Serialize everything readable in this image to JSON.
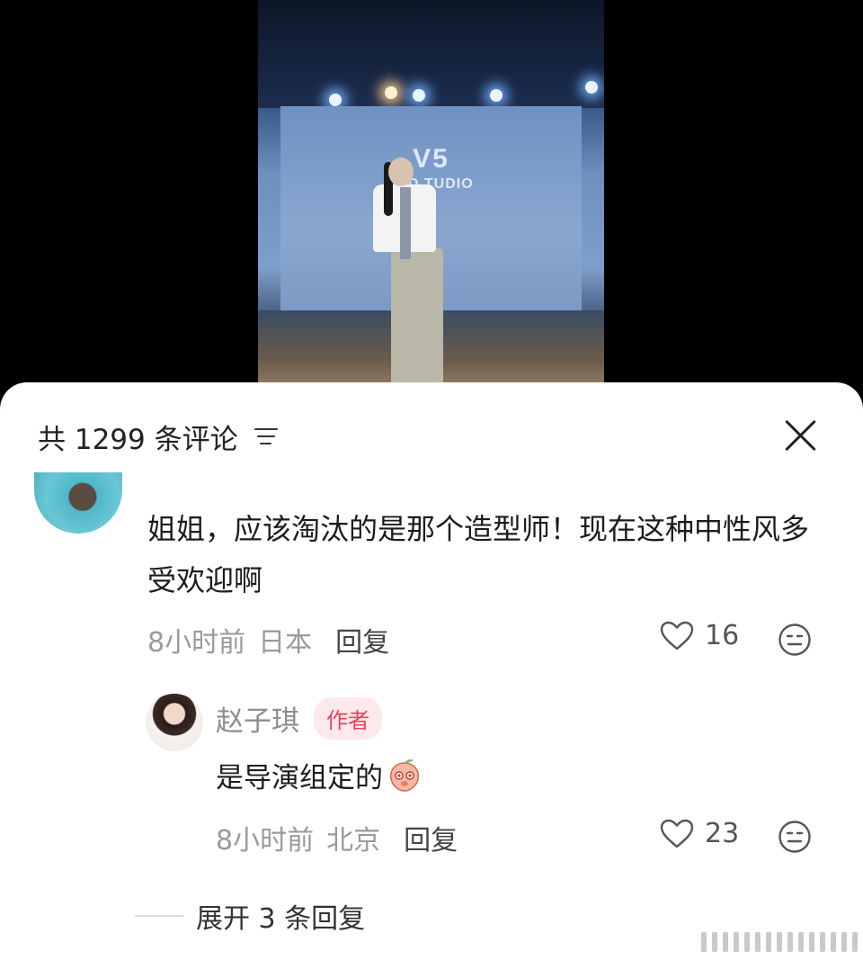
{
  "video": {
    "studio_mark": "V5",
    "studio_name": "V5D  TUDIO"
  },
  "comments_panel": {
    "title": "共 1299 条评论"
  },
  "top_comment": {
    "text": "姐姐，应该淘汰的是那个造型师！现在这种中性风多受欢迎啊",
    "time": "8小时前",
    "location": "日本",
    "reply_label": "回复",
    "likes": "16"
  },
  "author_reply": {
    "name": "赵子琪",
    "badge": "作者",
    "text": "是导演组定的",
    "time": "8小时前",
    "location": "北京",
    "reply_label": "回复",
    "likes": "23"
  },
  "expand": {
    "label": "展开 3 条回复"
  },
  "colors": {
    "badge_bg": "#fde8ec",
    "badge_text": "#e8415e",
    "meta_gray": "#9a9a9a"
  },
  "icons": [
    "sort-icon",
    "close-icon",
    "heart-icon",
    "dislike-face-icon",
    "peach-emoji-icon"
  ]
}
